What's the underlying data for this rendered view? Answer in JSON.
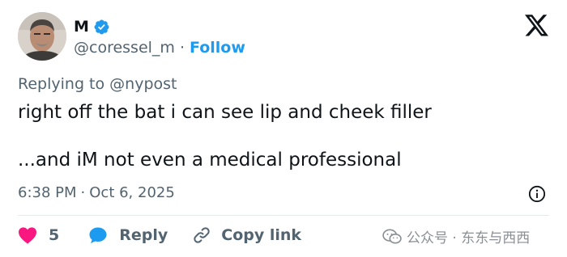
{
  "author": {
    "name": "M",
    "handle": "@coressel_m",
    "separator": "·",
    "follow_label": "Follow"
  },
  "reply_context": {
    "prefix": "Replying to",
    "handle": "@nypost"
  },
  "tweet": {
    "line1": "right off the bat i can see lip and cheek filler",
    "line2": "...and iM not even a medical professional"
  },
  "meta": {
    "time": "6:38 PM",
    "separator": "·",
    "date": "Oct 6, 2025"
  },
  "actions": {
    "like_count": "5",
    "reply_label": "Reply",
    "copy_label": "Copy link"
  },
  "watermark": {
    "text": "公众号 · 东东与西西"
  },
  "colors": {
    "accent": "#1d9bf0",
    "heart": "#f91880",
    "text": "#0f1419",
    "muted": "#536471"
  },
  "icons": [
    "verified-badge-icon",
    "x-logo-icon",
    "info-icon",
    "heart-icon",
    "reply-bubble-icon",
    "link-icon",
    "wechat-icon"
  ]
}
